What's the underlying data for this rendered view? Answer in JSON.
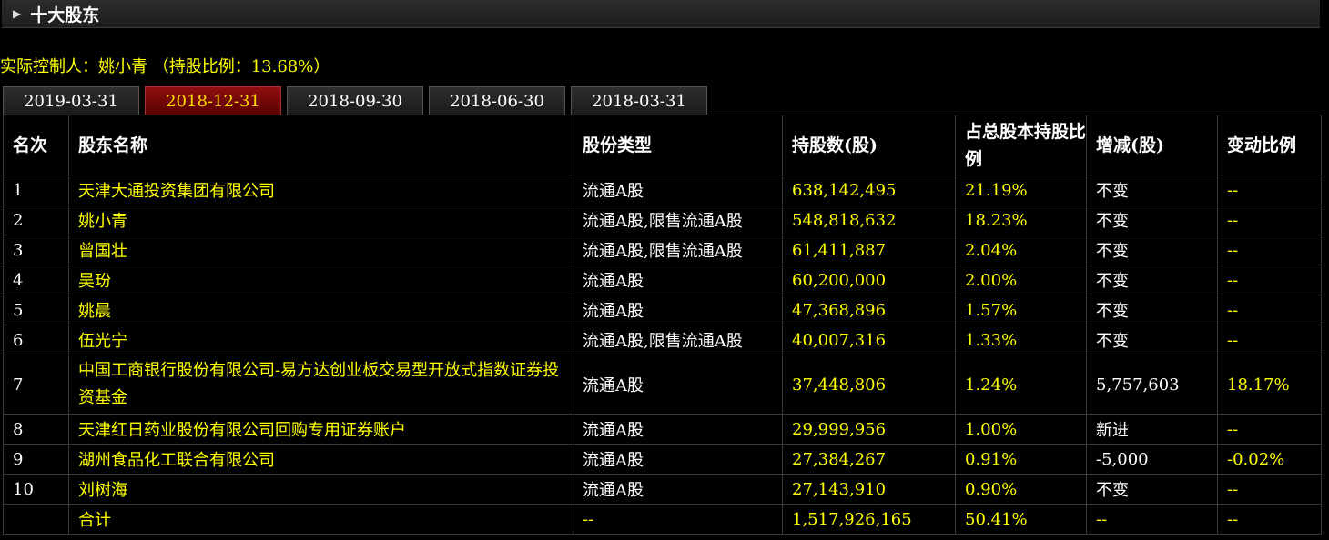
{
  "section": {
    "title": "十大股东",
    "toggle": "▶"
  },
  "controller": {
    "text": "实际控制人：姚小青 （持股比例：13.68%）"
  },
  "tabs": [
    {
      "label": "2019-03-31"
    },
    {
      "label": "2018-12-31",
      "active": true
    },
    {
      "label": "2018-09-30"
    },
    {
      "label": "2018-06-30"
    },
    {
      "label": "2018-03-31"
    }
  ],
  "table": {
    "headers": [
      "名次",
      "股东名称",
      "股份类型",
      "持股数(股)",
      "占总股本持股比例",
      "增减(股)",
      "变动比例"
    ],
    "rows": [
      [
        "1",
        "天津大通投资集团有限公司",
        "流通A股",
        "638,142,495",
        "21.19%",
        "不变",
        "--"
      ],
      [
        "2",
        "姚小青",
        "流通A股,限售流通A股",
        "548,818,632",
        "18.23%",
        "不变",
        "--"
      ],
      [
        "3",
        "曾国壮",
        "流通A股,限售流通A股",
        "61,411,887",
        "2.04%",
        "不变",
        "--"
      ],
      [
        "4",
        "吴玢",
        "流通A股",
        "60,200,000",
        "2.00%",
        "不变",
        "--"
      ],
      [
        "5",
        "姚晨",
        "流通A股",
        "47,368,896",
        "1.57%",
        "不变",
        "--"
      ],
      [
        "6",
        "伍光宁",
        "流通A股,限售流通A股",
        "40,007,316",
        "1.33%",
        "不变",
        "--"
      ],
      [
        "7",
        "中国工商银行股份有限公司-易方达创业板交易型开放式指数证券投资基金",
        "流通A股",
        "37,448,806",
        "1.24%",
        "5,757,603",
        "18.17%"
      ],
      [
        "8",
        "天津红日药业股份有限公司回购专用证券账户",
        "流通A股",
        "29,999,956",
        "1.00%",
        "新进",
        "--"
      ],
      [
        "9",
        "湖州食品化工联合有限公司",
        "流通A股",
        "27,384,267",
        "0.91%",
        "-5,000",
        "-0.02%"
      ],
      [
        "10",
        "刘树海",
        "流通A股",
        "27,143,910",
        "0.90%",
        "不变",
        "--"
      ]
    ],
    "total": [
      "",
      "合计",
      "--",
      "1,517,926,165",
      "50.41%",
      "--",
      "--"
    ]
  },
  "colors": {
    "accent": "#ffff00",
    "active_tab": "#8e0f0f",
    "background": "#000000"
  }
}
